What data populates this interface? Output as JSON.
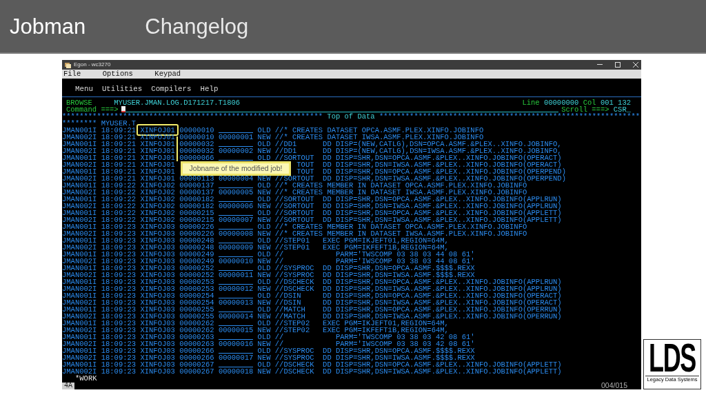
{
  "slide": {
    "title": "Jobman",
    "subtitle": "Changelog",
    "page": "004/015",
    "logo": {
      "text": "LDS",
      "caption": "Legacy Data Systems"
    }
  },
  "window": {
    "title": "Egon - wc3270",
    "menu": [
      "File",
      "Options",
      "Keypad"
    ]
  },
  "terminal": {
    "action_bar": [
      "Menu",
      "Utilities",
      "Compilers",
      "Help"
    ],
    "mode": "BROWSE",
    "dataset": "MYUSER.JMAN.LOG.D171217.T1806",
    "line_label": "Line",
    "line_value": "00000000",
    "col_label": "Col",
    "col_value": "001 132",
    "command_label": "Command ===>",
    "scroll_label": "Scroll ===>",
    "scroll_value": "CSR_",
    "top_rule_left": "************************************************************",
    "top_label": "Top of Data",
    "top_rule_right": "************************************************************",
    "header_line": "******** MYUSER.T",
    "rows": [
      {
        "kind": "full",
        "highlighted": true,
        "prefix": "JMAN001I",
        "time": "18:09:21",
        "job": "XINFOJ01",
        "seq": "00000010",
        "status": "OLD",
        "statement": "//* CREATES DATASET OPCA.ASMF.PLEX.XINFO.JOBINFO"
      },
      {
        "kind": "full",
        "highlighted": false,
        "prefix": "JMAN002I",
        "time": "18:09:21",
        "job": "XINFOJ01",
        "seq": "00000010",
        "new_seq": "00000001",
        "status": "NEW",
        "statement": "//* CREATES DATASET IWSA.ASMF.PLEX.XINFO.JOBINFO"
      },
      {
        "kind": "full",
        "highlighted": false,
        "prefix": "JMAN001I",
        "time": "18:09:21",
        "job": "XINFOJ01",
        "seq": "00000032",
        "status": "OLD",
        "statement": "//DD1      DD DISP=(NEW,CATLG),DSN=OPCA.ASMF.&PLEX..XINFO.JOBINFO,"
      },
      {
        "kind": "full",
        "highlighted": false,
        "prefix": "JMAN002I",
        "time": "18:09:21",
        "job": "XINFOJ01",
        "seq": "00000032",
        "new_seq": "00000002",
        "status": "NEW",
        "statement": "//DD1      DD DISP=(NEW,CATLG),DSN=IWSA.ASMF.&PLEX..XINFO.JOBINFO,"
      },
      {
        "kind": "full",
        "highlighted": false,
        "prefix": "JMAN001I",
        "time": "18:09:21",
        "job": "XINFOJ01",
        "seq": "00000066",
        "status": "OLD",
        "statement": "//SORTOUT  DD DISP=SHR,DSN=OPCA.ASMF.&PLEX..XINFO.JOBINFO(OPERACT)"
      },
      {
        "kind": "covered",
        "highlighted": false,
        "prefix": "JMAN002I",
        "time": "18:09:21",
        "job": "XINFOJ01",
        "statement": "TOUT  DD DISP=SHR,DSN=IWSA.ASMF.&PLEX..XINFO.JOBINFO(OPERACT)"
      },
      {
        "kind": "covered",
        "highlighted": false,
        "prefix": "JMAN001I",
        "time": "18:09:21",
        "job": "XINFOJ01",
        "statement": "TOUT  DD DISP=SHR,DSN=OPCA.ASMF.&PLEX..XINFO.JOBINFO(OPERPEND)"
      },
      {
        "kind": "full",
        "highlighted": false,
        "prefix": "JMAN002I",
        "time": "18:09:21",
        "job": "XINFOJ01",
        "seq": "00000113",
        "new_seq": "00000004",
        "status": "NEW",
        "statement": "//SORTOUT  DD DISP=SHR,DSN=IWSA.ASMF.&PLEX..XINFO.JOBINFO(OPERPEND)"
      },
      {
        "kind": "full",
        "highlighted": false,
        "prefix": "JMAN001I",
        "time": "18:09:22",
        "job": "XINFOJ02",
        "seq": "00000137",
        "status": "OLD",
        "statement": "//* CREATES MEMBER IN DATASET OPCA.ASMF.PLEX.XINFO.JOBINFO"
      },
      {
        "kind": "full",
        "highlighted": false,
        "prefix": "JMAN002I",
        "time": "18:09:22",
        "job": "XINFOJ02",
        "seq": "00000137",
        "new_seq": "00000005",
        "status": "NEW",
        "statement": "//* CREATES MEMBER IN DATASET IWSA.ASMF.PLEX.XINFO.JOBINFO"
      },
      {
        "kind": "full",
        "highlighted": false,
        "prefix": "JMAN001I",
        "time": "18:09:22",
        "job": "XINFOJ02",
        "seq": "00000182",
        "status": "OLD",
        "statement": "//SORTOUT  DD DISP=SHR,DSN=OPCA.ASMF.&PLEX..XINFO.JOBINFO(APPLRUN)"
      },
      {
        "kind": "full",
        "highlighted": false,
        "prefix": "JMAN002I",
        "time": "18:09:22",
        "job": "XINFOJ02",
        "seq": "00000182",
        "new_seq": "00000006",
        "status": "NEW",
        "statement": "//SORTOUT  DD DISP=SHR,DSN=IWSA.ASMF.&PLEX..XINFO.JOBINFO(APPLRUN)"
      },
      {
        "kind": "full",
        "highlighted": false,
        "prefix": "JMAN001I",
        "time": "18:09:22",
        "job": "XINFOJ02",
        "seq": "00000215",
        "status": "OLD",
        "statement": "//SORTOUT  DD DISP=SHR,DSN=OPCA.ASMF.&PLEX..XINFO.JOBINFO(APPLETT)"
      },
      {
        "kind": "full",
        "highlighted": false,
        "prefix": "JMAN002I",
        "time": "18:09:22",
        "job": "XINFOJ02",
        "seq": "00000215",
        "new_seq": "00000007",
        "status": "NEW",
        "statement": "//SORTOUT  DD DISP=SHR,DSN=IWSA.ASMF.&PLEX..XINFO.JOBINFO(APPLETT)"
      },
      {
        "kind": "full",
        "highlighted": false,
        "prefix": "JMAN001I",
        "time": "18:09:23",
        "job": "XINFOJ03",
        "seq": "00000226",
        "status": "OLD",
        "statement": "//* CREATES MEMBER IN DATASET OPCA.ASMF.PLEX.XINFO.JOBINFO"
      },
      {
        "kind": "full",
        "highlighted": false,
        "prefix": "JMAN002I",
        "time": "18:09:23",
        "job": "XINFOJ03",
        "seq": "00000226",
        "new_seq": "00000008",
        "status": "NEW",
        "statement": "//* CREATES MEMBER IN DATASET IWSA.ASMF.PLEX.XINFO.JOBINFO"
      },
      {
        "kind": "full",
        "highlighted": false,
        "prefix": "JMAN001I",
        "time": "18:09:23",
        "job": "XINFOJ03",
        "seq": "00000248",
        "status": "OLD",
        "statement": "//STEP01   EXEC PGM=IKJEFT01,REGION=64M,"
      },
      {
        "kind": "full",
        "highlighted": false,
        "prefix": "JMAN002I",
        "time": "18:09:23",
        "job": "XINFOJ03",
        "seq": "00000248",
        "new_seq": "00000009",
        "status": "NEW",
        "statement": "//STEP01   EXEC PGM=IKFEFT1B,REGION=64M,"
      },
      {
        "kind": "full",
        "highlighted": false,
        "prefix": "JMAN001I",
        "time": "18:09:23",
        "job": "XINFOJ03",
        "seq": "00000249",
        "status": "OLD",
        "statement": "//            PARM='TWSCOMP 03 38 03 44 08 61'"
      },
      {
        "kind": "full",
        "highlighted": false,
        "prefix": "JMAN002I",
        "time": "18:09:23",
        "job": "XINFOJ03",
        "seq": "00000249",
        "new_seq": "00000010",
        "status": "NEW",
        "statement": "//            PARM='IWSCOMP 03 38 03 44 08 61'"
      },
      {
        "kind": "full",
        "highlighted": false,
        "prefix": "JMAN001I",
        "time": "18:09:23",
        "job": "XINFOJ03",
        "seq": "00000252",
        "status": "OLD",
        "statement": "//SYSPROC  DD DISP=SHR,DSN=OPCA.ASMF.$$$$.REXX"
      },
      {
        "kind": "full",
        "highlighted": false,
        "prefix": "JMAN002I",
        "time": "18:09:23",
        "job": "XINFOJ03",
        "seq": "00000252",
        "new_seq": "00000011",
        "status": "NEW",
        "statement": "//SYSPROC  DD DISP=SHR,DSN=IWSA.ASMF.$$$$.REXX"
      },
      {
        "kind": "full",
        "highlighted": false,
        "prefix": "JMAN001I",
        "time": "18:09:23",
        "job": "XINFOJ03",
        "seq": "00000253",
        "status": "OLD",
        "statement": "//DSCHECK  DD DISP=SHR,DSN=OPCA.ASMF.&PLEX..XINFO.JOBINFO(APPLRUN)"
      },
      {
        "kind": "full",
        "highlighted": false,
        "prefix": "JMAN002I",
        "time": "18:09:23",
        "job": "XINFOJ03",
        "seq": "00000253",
        "new_seq": "00000012",
        "status": "NEW",
        "statement": "//DSCHECK  DD DISP=SHR,DSN=IWSA.ASMF.&PLEX..XINFO.JOBINFO(APPLRUN)"
      },
      {
        "kind": "full",
        "highlighted": false,
        "prefix": "JMAN001I",
        "time": "18:09:23",
        "job": "XINFOJ03",
        "seq": "00000254",
        "status": "OLD",
        "statement": "//DSIN     DD DISP=SHR,DSN=OPCA.ASMF.&PLEX..XINFO.JOBINFO(OPERACT)"
      },
      {
        "kind": "full",
        "highlighted": false,
        "prefix": "JMAN002I",
        "time": "18:09:23",
        "job": "XINFOJ03",
        "seq": "00000254",
        "new_seq": "00000013",
        "status": "NEW",
        "statement": "//DSIN     DD DISP=SHR,DSN=IWSA.ASMF.&PLEX..XINFO.JOBINFO(OPERACT)"
      },
      {
        "kind": "full",
        "highlighted": false,
        "prefix": "JMAN001I",
        "time": "18:09:23",
        "job": "XINFOJ03",
        "seq": "00000255",
        "status": "OLD",
        "statement": "//MATCH    DD DISP=SHR,DSN=OPCA.ASMF.&PLEX..XINFO.JOBINFO(OPERRUN)"
      },
      {
        "kind": "full",
        "highlighted": false,
        "prefix": "JMAN002I",
        "time": "18:09:23",
        "job": "XINFOJ03",
        "seq": "00000255",
        "new_seq": "00000014",
        "status": "NEW",
        "statement": "//MATCH    DD DISP=SHR,DSN=IWSA.ASMF.&PLEX..XINFO.JOBINFO(OPERRUN)"
      },
      {
        "kind": "full",
        "highlighted": false,
        "prefix": "JMAN001I",
        "time": "18:09:23",
        "job": "XINFOJ03",
        "seq": "00000262",
        "status": "OLD",
        "statement": "//STEP02   EXEC PGM=IKJEFT01,REGION=64M,"
      },
      {
        "kind": "full",
        "highlighted": false,
        "prefix": "JMAN002I",
        "time": "18:09:23",
        "job": "XINFOJ03",
        "seq": "00000262",
        "new_seq": "00000015",
        "status": "NEW",
        "statement": "//STEP02   EXEC PGM=IKFEFT1B,REGION=64M,"
      },
      {
        "kind": "full",
        "highlighted": false,
        "prefix": "JMAN001I",
        "time": "18:09:23",
        "job": "XINFOJ03",
        "seq": "00000263",
        "status": "OLD",
        "statement": "//            PARM='TWSCOMP 03 38 03 42 08 61'"
      },
      {
        "kind": "full",
        "highlighted": false,
        "prefix": "JMAN002I",
        "time": "18:09:23",
        "job": "XINFOJ03",
        "seq": "00000263",
        "new_seq": "00000016",
        "status": "NEW",
        "statement": "//            PARM='IWSCOMP 03 38 03 42 08 61'"
      },
      {
        "kind": "full",
        "highlighted": false,
        "prefix": "JMAN001I",
        "time": "18:09:23",
        "job": "XINFOJ03",
        "seq": "00000266",
        "status": "OLD",
        "statement": "//SYSPROC  DD DISP=SHR,DSN=OPCA.ASMF.$$$$.REXX"
      },
      {
        "kind": "full",
        "highlighted": false,
        "prefix": "JMAN002I",
        "time": "18:09:23",
        "job": "XINFOJ03",
        "seq": "00000266",
        "new_seq": "00000017",
        "status": "NEW",
        "statement": "//SYSPROC  DD DISP=SHR,DSN=IWSA.ASMF.$$$$.REXX"
      },
      {
        "kind": "full",
        "highlighted": false,
        "prefix": "JMAN001I",
        "time": "18:09:23",
        "job": "XINFOJ03",
        "seq": "00000267",
        "status": "OLD",
        "statement": "//DSCHECK  DD DISP=SHR,DSN=OPCA.ASMF.&PLEX..XINFO.JOBINFO(APPLETT)"
      },
      {
        "kind": "full",
        "highlighted": false,
        "prefix": "JMAN002I",
        "time": "18:09:23",
        "job": "XINFOJ03",
        "seq": "00000267",
        "new_seq": "00000018",
        "status": "NEW",
        "statement": "//DSCHECK  DD DISP=SHR,DSN=IWSA.ASMF.&PLEX..XINFO.JOBINFO(APPLETT)"
      }
    ],
    "footer": "*WORK",
    "status": "4A"
  },
  "callout": {
    "text": "Jobname of the modified job!"
  }
}
